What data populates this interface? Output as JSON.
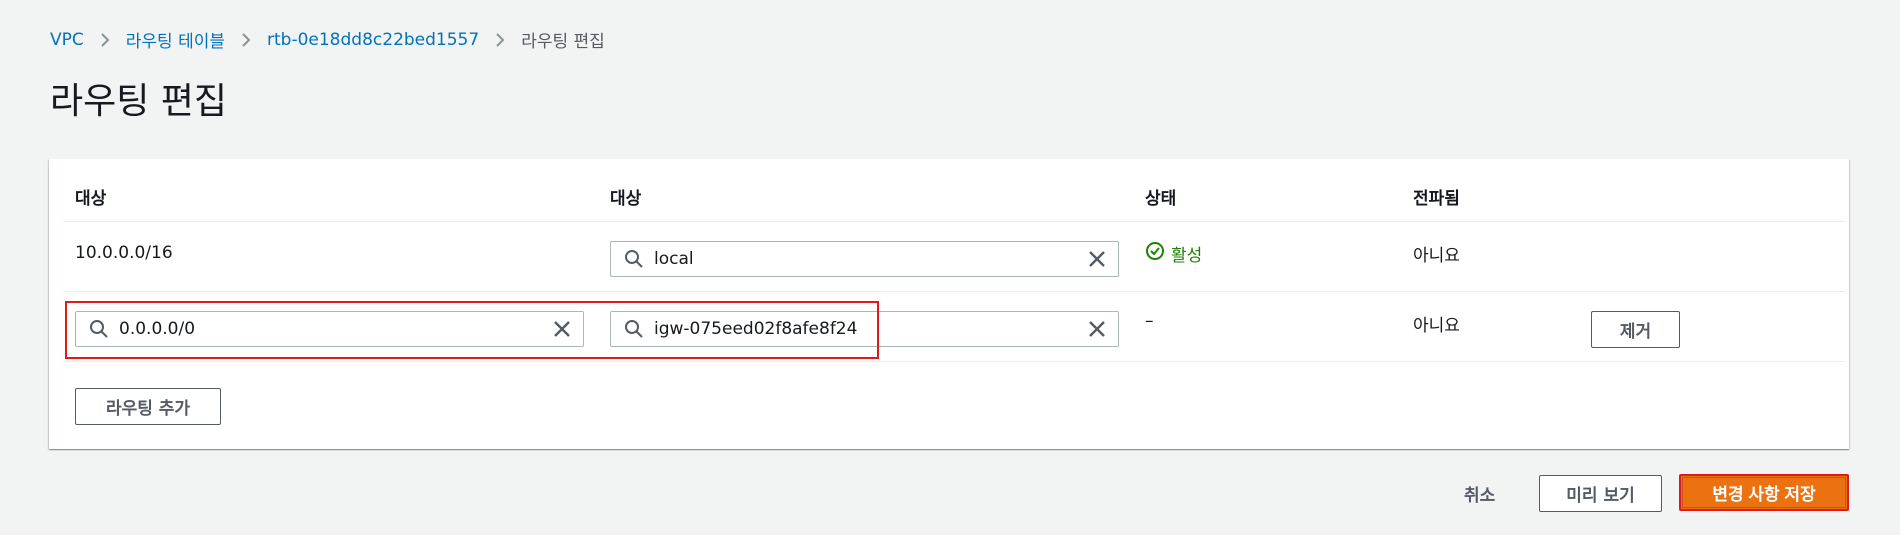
{
  "breadcrumb": {
    "items": [
      {
        "label": "VPC"
      },
      {
        "label": "라우팅 테이블"
      },
      {
        "label": "rtb-0e18dd8c22bed1557"
      }
    ],
    "current": "라우팅 편집"
  },
  "page": {
    "title": "라우팅 편집"
  },
  "table": {
    "headers": {
      "destination": "대상",
      "target": "대상",
      "status": "상태",
      "propagated": "전파됨"
    },
    "rows": [
      {
        "destination": "10.0.0.0/16",
        "target": "local",
        "status": "활성",
        "propagated": "아니요"
      },
      {
        "destination": "0.0.0.0/0",
        "target": "igw-075eed02f8afe8f24",
        "status": "–",
        "propagated": "아니요",
        "remove_label": "제거"
      }
    ],
    "add_route_label": "라우팅 추가"
  },
  "footer": {
    "cancel_label": "취소",
    "preview_label": "미리 보기",
    "save_label": "변경 사항 저장"
  },
  "colors": {
    "link": "#0073bb",
    "primary": "#ec7211",
    "success": "#1d8102",
    "highlight": "#e01a1a"
  },
  "icons": [
    "chevron-right-icon",
    "search-icon",
    "clear-icon",
    "status-success-icon"
  ]
}
